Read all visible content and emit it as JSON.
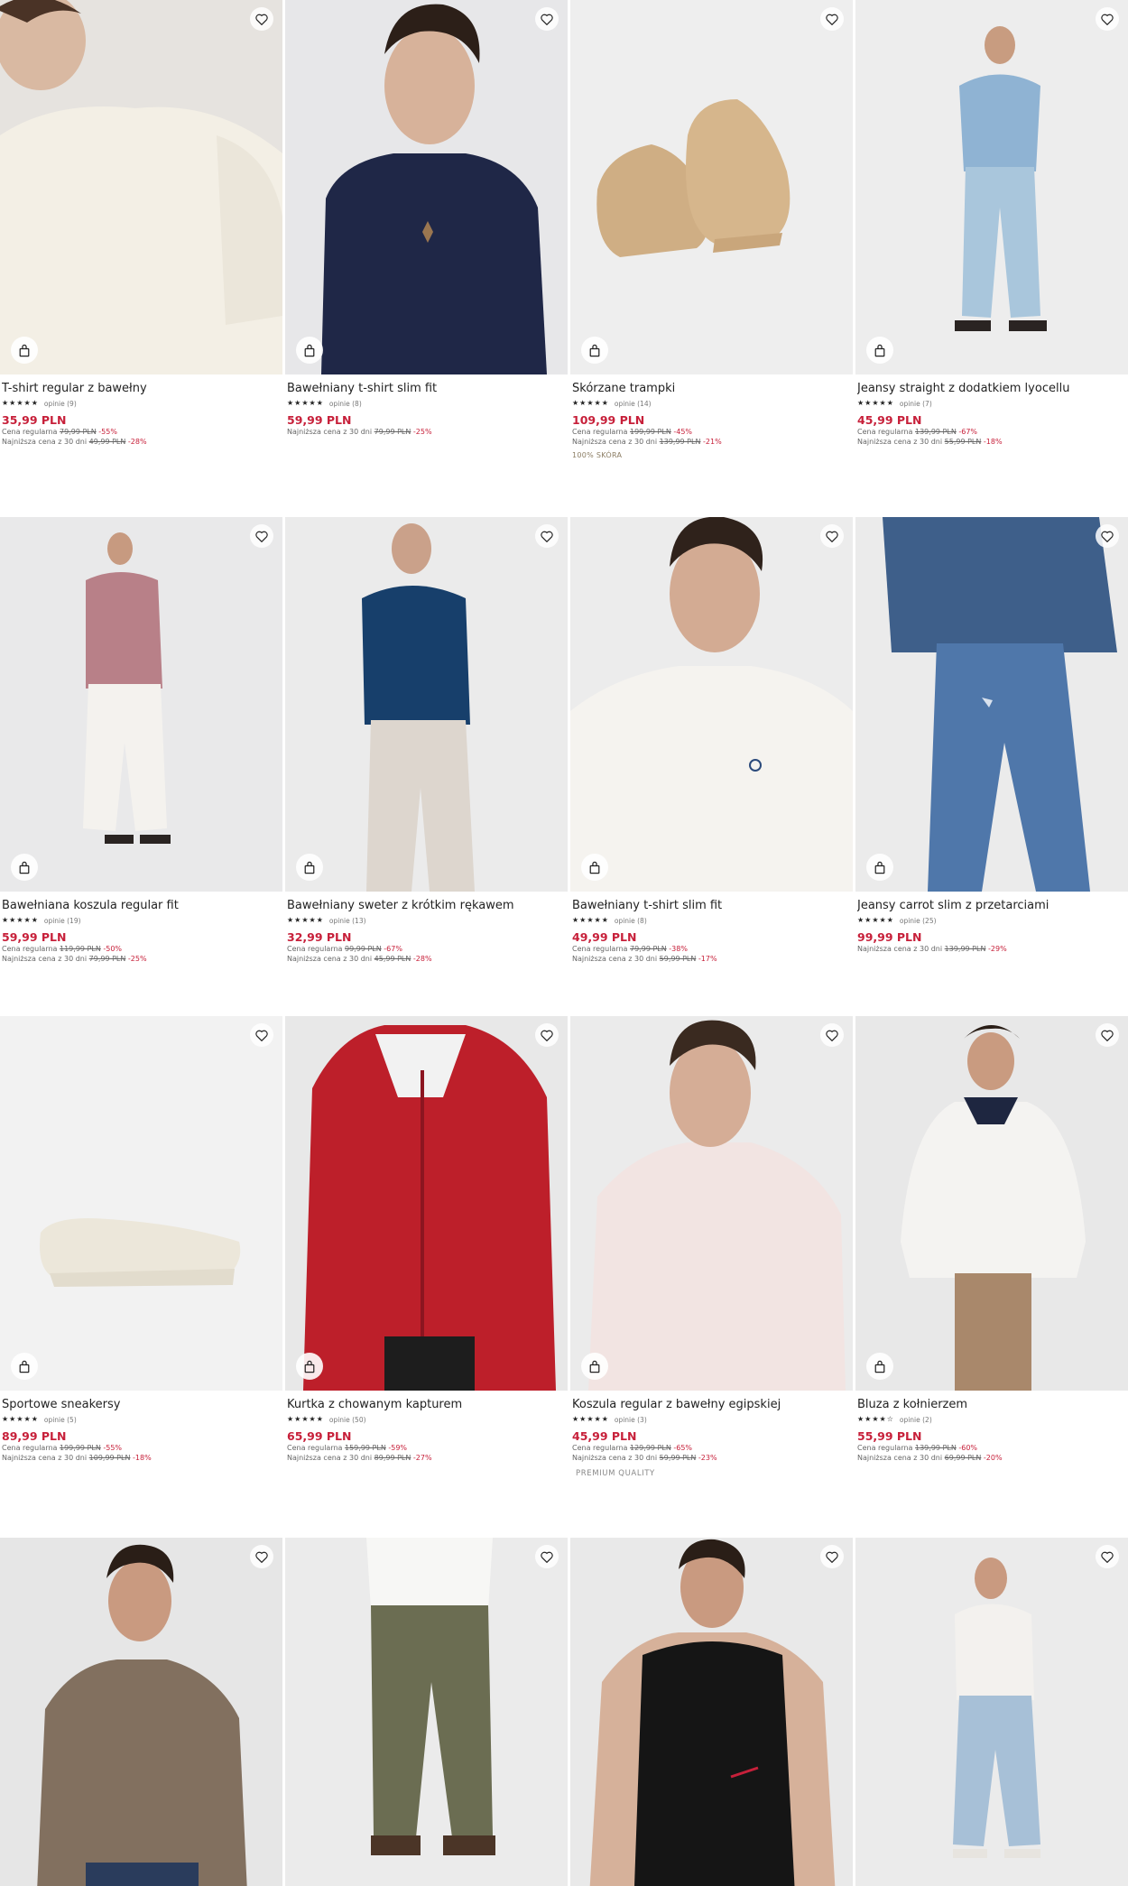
{
  "products": [
    {
      "name": "T-shirt regular z bawełny",
      "stars": "★★★★★",
      "reviews": "opinie (9)",
      "price": "35,99 PLN",
      "regular_label": "Cena regularna",
      "regular_price": "79,99 PLN",
      "regular_discount": "-55%",
      "lowest_label": "Najniższa cena z 30 dni",
      "lowest_price": "49,99 PLN",
      "lowest_discount": "-28%",
      "badge": ""
    },
    {
      "name": "Bawełniany t-shirt slim fit",
      "stars": "★★★★★",
      "reviews": "opinie (8)",
      "price": "59,99 PLN",
      "regular_label": "",
      "regular_price": "",
      "regular_discount": "",
      "lowest_label": "Najniższa cena z 30 dni",
      "lowest_price": "79,99 PLN",
      "lowest_discount": "-25%",
      "badge": ""
    },
    {
      "name": "Skórzane trampki",
      "stars": "★★★★★",
      "reviews": "opinie (14)",
      "price": "109,99 PLN",
      "regular_label": "Cena regularna",
      "regular_price": "199,99 PLN",
      "regular_discount": "-45%",
      "lowest_label": "Najniższa cena z 30 dni",
      "lowest_price": "139,99 PLN",
      "lowest_discount": "-21%",
      "badge": "100% SKÓRA"
    },
    {
      "name": "Jeansy straight z dodatkiem lyocellu",
      "stars": "★★★★★",
      "reviews": "opinie (7)",
      "price": "45,99 PLN",
      "regular_label": "Cena regularna",
      "regular_price": "139,99 PLN",
      "regular_discount": "-67%",
      "lowest_label": "Najniższa cena z 30 dni",
      "lowest_price": "55,99 PLN",
      "lowest_discount": "-18%",
      "badge": ""
    },
    {
      "name": "Bawełniana koszula regular fit",
      "stars": "★★★★★",
      "reviews": "opinie (19)",
      "price": "59,99 PLN",
      "regular_label": "Cena regularna",
      "regular_price": "119,99 PLN",
      "regular_discount": "-50%",
      "lowest_label": "Najniższa cena z 30 dni",
      "lowest_price": "79,99 PLN",
      "lowest_discount": "-25%",
      "badge": ""
    },
    {
      "name": "Bawełniany sweter z krótkim rękawem",
      "stars": "★★★★★",
      "reviews": "opinie (13)",
      "price": "32,99 PLN",
      "regular_label": "Cena regularna",
      "regular_price": "99,99 PLN",
      "regular_discount": "-67%",
      "lowest_label": "Najniższa cena z 30 dni",
      "lowest_price": "45,99 PLN",
      "lowest_discount": "-28%",
      "badge": ""
    },
    {
      "name": "Bawełniany t-shirt slim fit",
      "stars": "★★★★★",
      "reviews": "opinie (8)",
      "price": "49,99 PLN",
      "regular_label": "Cena regularna",
      "regular_price": "79,99 PLN",
      "regular_discount": "-38%",
      "lowest_label": "Najniższa cena z 30 dni",
      "lowest_price": "59,99 PLN",
      "lowest_discount": "-17%",
      "badge": ""
    },
    {
      "name": "Jeansy carrot slim z przetarciami",
      "stars": "★★★★★",
      "reviews": "opinie (25)",
      "price": "99,99 PLN",
      "regular_label": "",
      "regular_price": "",
      "regular_discount": "",
      "lowest_label": "Najniższa cena z 30 dni",
      "lowest_price": "139,99 PLN",
      "lowest_discount": "-29%",
      "badge": ""
    },
    {
      "name": "Sportowe sneakersy",
      "stars": "★★★★★",
      "reviews": "opinie (5)",
      "price": "89,99 PLN",
      "regular_label": "Cena regularna",
      "regular_price": "199,99 PLN",
      "regular_discount": "-55%",
      "lowest_label": "Najniższa cena z 30 dni",
      "lowest_price": "109,99 PLN",
      "lowest_discount": "-18%",
      "badge": ""
    },
    {
      "name": "Kurtka z chowanym kapturem",
      "stars": "★★★★★",
      "reviews": "opinie (50)",
      "price": "65,99 PLN",
      "regular_label": "Cena regularna",
      "regular_price": "159,99 PLN",
      "regular_discount": "-59%",
      "lowest_label": "Najniższa cena z 30 dni",
      "lowest_price": "89,99 PLN",
      "lowest_discount": "-27%",
      "badge": ""
    },
    {
      "name": "Koszula regular z bawełny egipskiej",
      "stars": "★★★★★",
      "reviews": "opinie (3)",
      "price": "45,99 PLN",
      "regular_label": "Cena regularna",
      "regular_price": "129,99 PLN",
      "regular_discount": "-65%",
      "lowest_label": "Najniższa cena z 30 dni",
      "lowest_price": "59,99 PLN",
      "lowest_discount": "-23%",
      "badge": "PREMIUM QUALITY"
    },
    {
      "name": "Bluza z kołnierzem",
      "stars": "★★★★☆",
      "reviews": "opinie (2)",
      "price": "55,99 PLN",
      "regular_label": "Cena regularna",
      "regular_price": "139,99 PLN",
      "regular_discount": "-60%",
      "lowest_label": "Najniższa cena z 30 dni",
      "lowest_price": "69,99 PLN",
      "lowest_discount": "-20%",
      "badge": ""
    },
    {
      "name": "",
      "stars": "",
      "reviews": "",
      "price": "",
      "regular_label": "",
      "regular_price": "",
      "regular_discount": "",
      "lowest_label": "",
      "lowest_price": "",
      "lowest_discount": "",
      "badge": ""
    },
    {
      "name": "",
      "stars": "",
      "reviews": "",
      "price": "",
      "regular_label": "",
      "regular_price": "",
      "regular_discount": "",
      "lowest_label": "",
      "lowest_price": "",
      "lowest_discount": "",
      "badge": ""
    },
    {
      "name": "",
      "stars": "",
      "reviews": "",
      "price": "",
      "regular_label": "",
      "regular_price": "",
      "regular_discount": "",
      "lowest_label": "",
      "lowest_price": "",
      "lowest_discount": "",
      "badge": ""
    },
    {
      "name": "",
      "stars": "",
      "reviews": "",
      "price": "",
      "regular_label": "",
      "regular_price": "",
      "regular_discount": "",
      "lowest_label": "",
      "lowest_price": "",
      "lowest_discount": "",
      "badge": ""
    }
  ],
  "icons": {
    "favorite": "heart-icon",
    "cart": "shopping-bag-icon"
  },
  "colors": {
    "sale_price": "#c7203a",
    "text": "#222222",
    "muted": "#666666"
  }
}
